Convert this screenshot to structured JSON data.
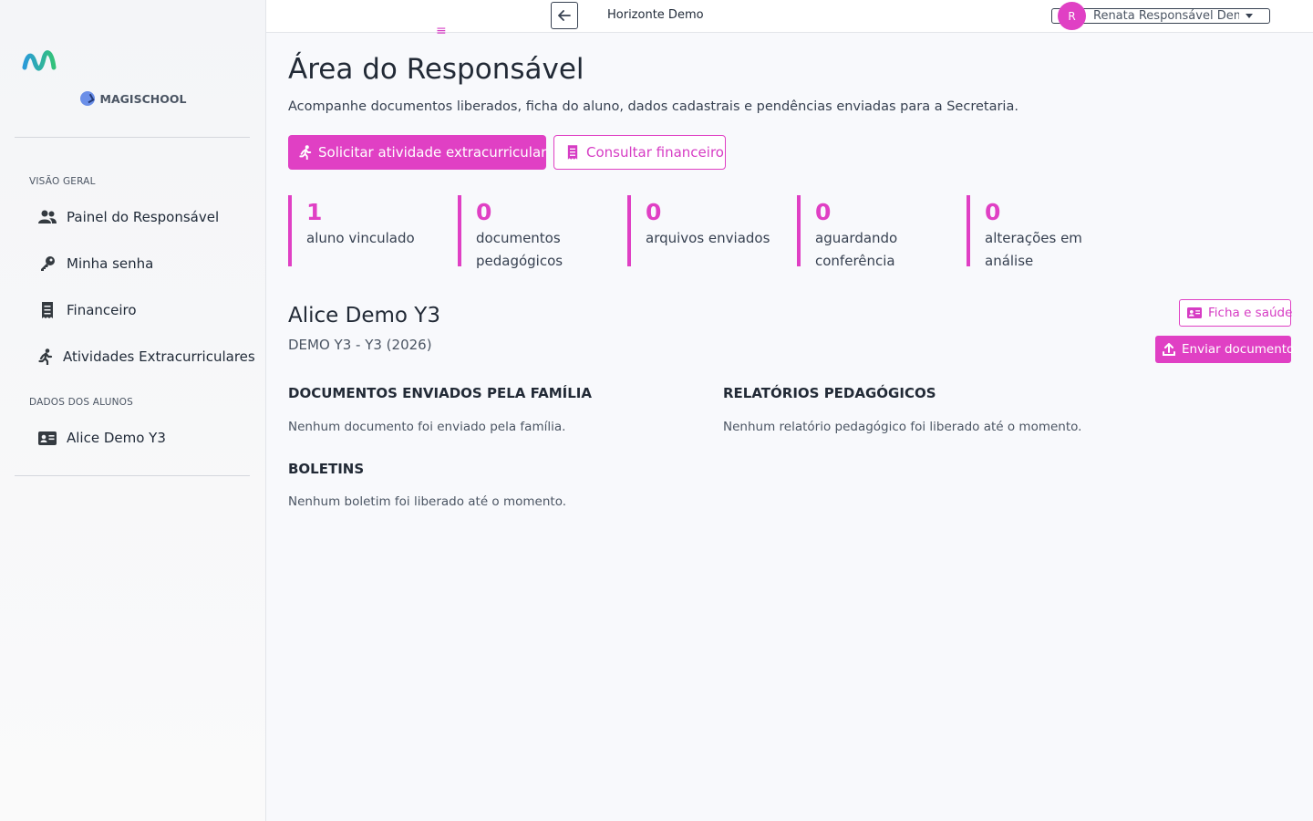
{
  "brand": {
    "school_name": "MAGISCHOOL",
    "logo_colors": [
      "#2a9bd8",
      "#33c27a"
    ]
  },
  "sidebar": {
    "section_overview": "VISÃO GERAL",
    "items": [
      {
        "label": "Painel do Responsável",
        "icon": "users-icon"
      },
      {
        "label": "Minha senha",
        "icon": "key-icon"
      },
      {
        "label": "Financeiro",
        "icon": "receipt-icon"
      },
      {
        "label": "Atividades Extracurriculares",
        "icon": "running-icon"
      }
    ],
    "section_students": "DADOS DOS ALUNOS",
    "students": [
      {
        "label": "Alice Demo Y3",
        "icon": "id-card-icon"
      }
    ]
  },
  "topbar": {
    "school": "Horizonte Demo",
    "avatar_initial": "R",
    "user_name": "Renata Responsável Demo"
  },
  "page": {
    "title": "Área do Responsável",
    "lead": "Acompanhe documentos liberados, ficha do aluno, dados cadastrais e pendências enviadas para a Secretaria.",
    "btn_activity": "Solicitar atividade extracurricular",
    "btn_finance": "Consultar financeiro"
  },
  "stats": [
    {
      "value": "1",
      "label": "aluno vinculado"
    },
    {
      "value": "0",
      "label": "documentos pedagógicos"
    },
    {
      "value": "0",
      "label": "arquivos enviados"
    },
    {
      "value": "0",
      "label": "aguardando conferência"
    },
    {
      "value": "0",
      "label": "alterações em análise"
    }
  ],
  "student": {
    "name": "Alice Demo Y3",
    "class": "DEMO Y3 - Y3 (2026)",
    "btn_health": "Ficha e saúde",
    "btn_upload": "Enviar documento"
  },
  "sections": {
    "family_docs_title": "DOCUMENTOS ENVIADOS PELA FAMÍLIA",
    "family_docs_empty": "Nenhum documento foi enviado pela família.",
    "reports_title": "RELATÓRIOS PEDAGÓGICOS",
    "reports_empty": "Nenhum relatório pedagógico foi liberado até o momento.",
    "grades_title": "BOLETINS",
    "grades_empty": "Nenhum boletim foi liberado até o momento."
  },
  "colors": {
    "accent": "#e040c4",
    "text": "#222a36"
  }
}
